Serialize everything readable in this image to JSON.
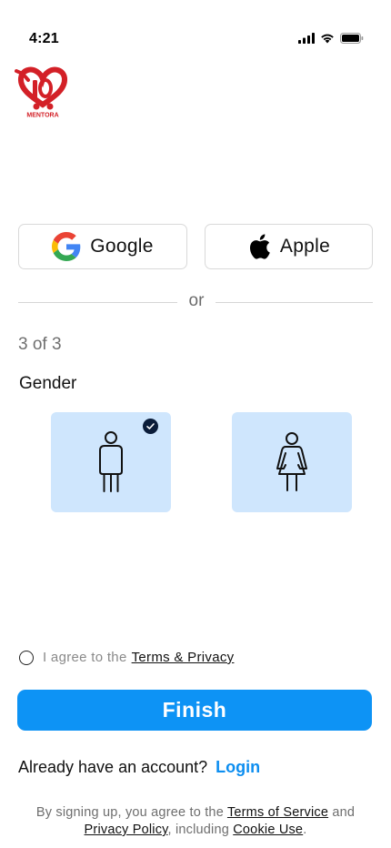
{
  "status_bar": {
    "time": "4:21",
    "icons": [
      "signal-icon",
      "wifi-icon",
      "battery-icon"
    ]
  },
  "logo": {
    "text": "MENTORA",
    "icon": "heart-logo-icon",
    "color": "#d32027"
  },
  "social": {
    "google_label": "Google",
    "apple_label": "Apple"
  },
  "divider_text": "or",
  "step": "3 of 3",
  "gender": {
    "label": "Gender",
    "options": [
      {
        "value": "male",
        "icon": "male-icon",
        "selected": true
      },
      {
        "value": "female",
        "icon": "female-icon",
        "selected": false
      }
    ]
  },
  "agree": {
    "text": "I agree to the",
    "link": "Terms & Privacy",
    "checked": false
  },
  "finish_label": "Finish",
  "account": {
    "text": "Already have an account?",
    "login": "Login"
  },
  "legal": {
    "prefix": "By signing up, you agree to the",
    "terms": "Terms of Service",
    "and": "and",
    "privacy": "Privacy Policy",
    "including": ", including",
    "cookie": "Cookie Use",
    "end": "."
  },
  "colors": {
    "accent": "#0d93f5",
    "card_bg": "#cfe6fd",
    "link": "#0d8ef0"
  }
}
